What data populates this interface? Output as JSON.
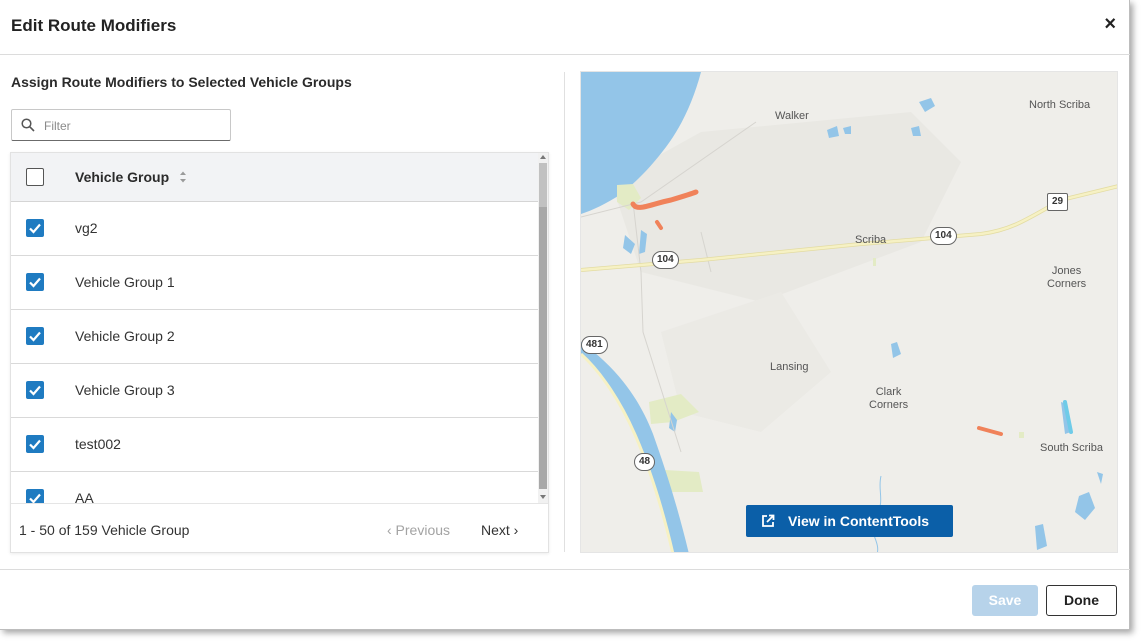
{
  "dialog": {
    "title": "Edit Route Modifiers",
    "close_label": "×"
  },
  "panel": {
    "subtitle": "Assign Route Modifiers to Selected Vehicle Groups",
    "filter_placeholder": "Filter",
    "filter_value": ""
  },
  "table": {
    "column_header": "Vehicle Group",
    "header_checked": false,
    "rows": [
      {
        "label": "vg2",
        "checked": true
      },
      {
        "label": "Vehicle Group 1",
        "checked": true
      },
      {
        "label": "Vehicle Group 2",
        "checked": true
      },
      {
        "label": "Vehicle Group 3",
        "checked": true
      },
      {
        "label": "test002",
        "checked": true
      },
      {
        "label": "AA",
        "checked": true
      }
    ],
    "pagination": {
      "count_text": "1 - 50 of 159 Vehicle Group",
      "previous_label": "‹  Previous",
      "next_label": "Next  ›"
    }
  },
  "map": {
    "places": {
      "walker": "Walker",
      "north_scriba": "North Scriba",
      "scriba": "Scriba",
      "jones_corners": "Jones\nCorners",
      "lansing": "Lansing",
      "clark_corners": "Clark\nCorners",
      "south_scriba": "South Scriba"
    },
    "shields": {
      "r104a": "104",
      "r104b": "104",
      "r29": "29",
      "r481": "481",
      "r48": "48"
    },
    "colors": {
      "water": "#93c5e8",
      "land": "#efeeea",
      "road": "#f6f1c4",
      "route_modifier": "#f0825a",
      "park": "#e3ebc5"
    }
  },
  "buttons": {
    "view_content_tools": "View in ContentTools",
    "save": "Save",
    "done": "Done"
  },
  "colors": {
    "accent": "#1f7bc1",
    "primary_button": "#0b5fa8",
    "disabled_button": "#b7d3ea"
  }
}
